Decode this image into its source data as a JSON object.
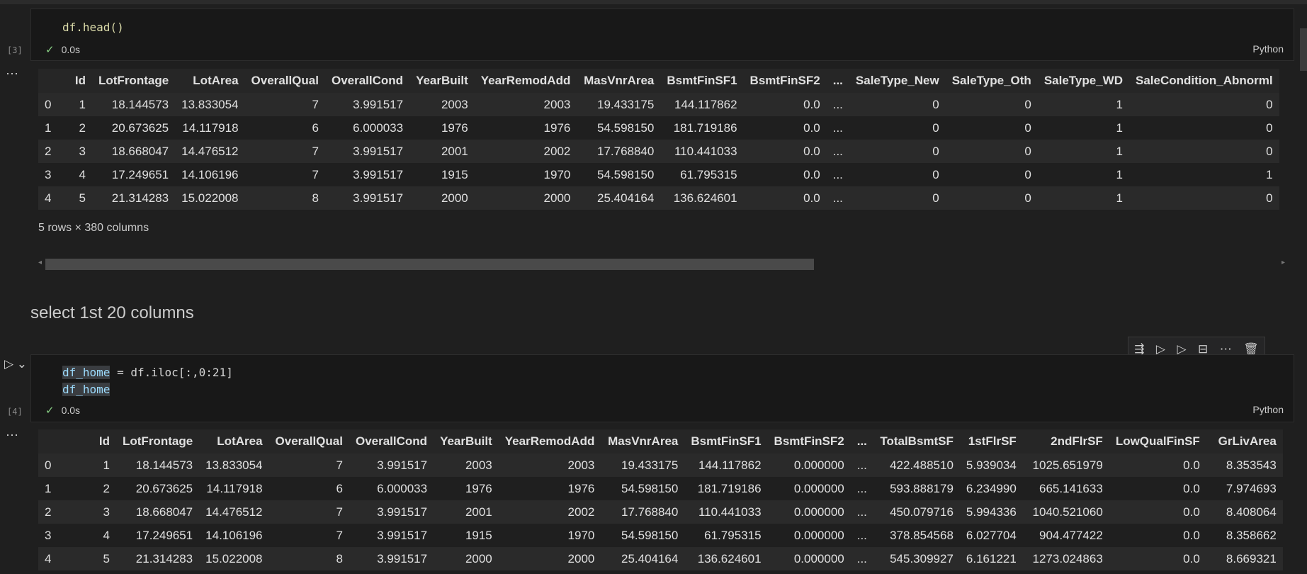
{
  "cell3": {
    "exec": "[3]",
    "code": "df.head()",
    "status_time": "0.0s",
    "lang": "Python",
    "output": {
      "columns": [
        "",
        "Id",
        "LotFrontage",
        "LotArea",
        "OverallQual",
        "OverallCond",
        "YearBuilt",
        "YearRemodAdd",
        "MasVnrArea",
        "BsmtFinSF1",
        "BsmtFinSF2",
        "...",
        "SaleType_New",
        "SaleType_Oth",
        "SaleType_WD",
        "SaleCondition_Abnorml"
      ],
      "rows": [
        [
          "0",
          "1",
          "18.144573",
          "13.833054",
          "7",
          "3.991517",
          "2003",
          "2003",
          "19.433175",
          "144.117862",
          "0.0",
          "...",
          "0",
          "0",
          "1",
          "0"
        ],
        [
          "1",
          "2",
          "20.673625",
          "14.117918",
          "6",
          "6.000033",
          "1976",
          "1976",
          "54.598150",
          "181.719186",
          "0.0",
          "...",
          "0",
          "0",
          "1",
          "0"
        ],
        [
          "2",
          "3",
          "18.668047",
          "14.476512",
          "7",
          "3.991517",
          "2001",
          "2002",
          "17.768840",
          "110.441033",
          "0.0",
          "...",
          "0",
          "0",
          "1",
          "0"
        ],
        [
          "3",
          "4",
          "17.249651",
          "14.106196",
          "7",
          "3.991517",
          "1915",
          "1970",
          "54.598150",
          "61.795315",
          "0.0",
          "...",
          "0",
          "0",
          "1",
          "1"
        ],
        [
          "4",
          "5",
          "21.314283",
          "15.022008",
          "8",
          "3.991517",
          "2000",
          "2000",
          "25.404164",
          "136.624601",
          "0.0",
          "...",
          "0",
          "0",
          "1",
          "0"
        ]
      ],
      "shape_note": "5 rows × 380 columns"
    }
  },
  "markdown": {
    "text": "select 1st 20 columns"
  },
  "cell4": {
    "exec": "[4]",
    "code_line1_var": "df_home",
    "code_line1_rest": " = df.iloc[:,0:21]",
    "code_line2": "df_home",
    "status_time": "0.0s",
    "lang": "Python",
    "output": {
      "columns": [
        "",
        "Id",
        "LotFrontage",
        "LotArea",
        "OverallQual",
        "OverallCond",
        "YearBuilt",
        "YearRemodAdd",
        "MasVnrArea",
        "BsmtFinSF1",
        "BsmtFinSF2",
        "...",
        "TotalBsmtSF",
        "1stFlrSF",
        "2ndFlrSF",
        "LowQualFinSF",
        "GrLivArea"
      ],
      "rows": [
        [
          "0",
          "1",
          "18.144573",
          "13.833054",
          "7",
          "3.991517",
          "2003",
          "2003",
          "19.433175",
          "144.117862",
          "0.000000",
          "...",
          "422.488510",
          "5.939034",
          "1025.651979",
          "0.0",
          "8.353543"
        ],
        [
          "1",
          "2",
          "20.673625",
          "14.117918",
          "6",
          "6.000033",
          "1976",
          "1976",
          "54.598150",
          "181.719186",
          "0.000000",
          "...",
          "593.888179",
          "6.234990",
          "665.141633",
          "0.0",
          "7.974693"
        ],
        [
          "2",
          "3",
          "18.668047",
          "14.476512",
          "7",
          "3.991517",
          "2001",
          "2002",
          "17.768840",
          "110.441033",
          "0.000000",
          "...",
          "450.079716",
          "5.994336",
          "1040.521060",
          "0.0",
          "8.408064"
        ],
        [
          "3",
          "4",
          "17.249651",
          "14.106196",
          "7",
          "3.991517",
          "1915",
          "1970",
          "54.598150",
          "61.795315",
          "0.000000",
          "...",
          "378.854568",
          "6.027704",
          "904.477422",
          "0.0",
          "8.358662"
        ],
        [
          "4",
          "5",
          "21.314283",
          "15.022008",
          "8",
          "3.991517",
          "2000",
          "2000",
          "25.404164",
          "136.624601",
          "0.000000",
          "...",
          "545.309927",
          "6.161221",
          "1273.024863",
          "0.0",
          "8.669321"
        ]
      ]
    }
  },
  "toolbar": {
    "icons": [
      "run-above-icon",
      "run-cell-above-icon",
      "run-cell-below-icon",
      "split-cell-icon",
      "more-icon",
      "trash-icon"
    ]
  },
  "icons": {
    "check": "check-icon",
    "run": "run-icon",
    "more": "more-icon"
  }
}
